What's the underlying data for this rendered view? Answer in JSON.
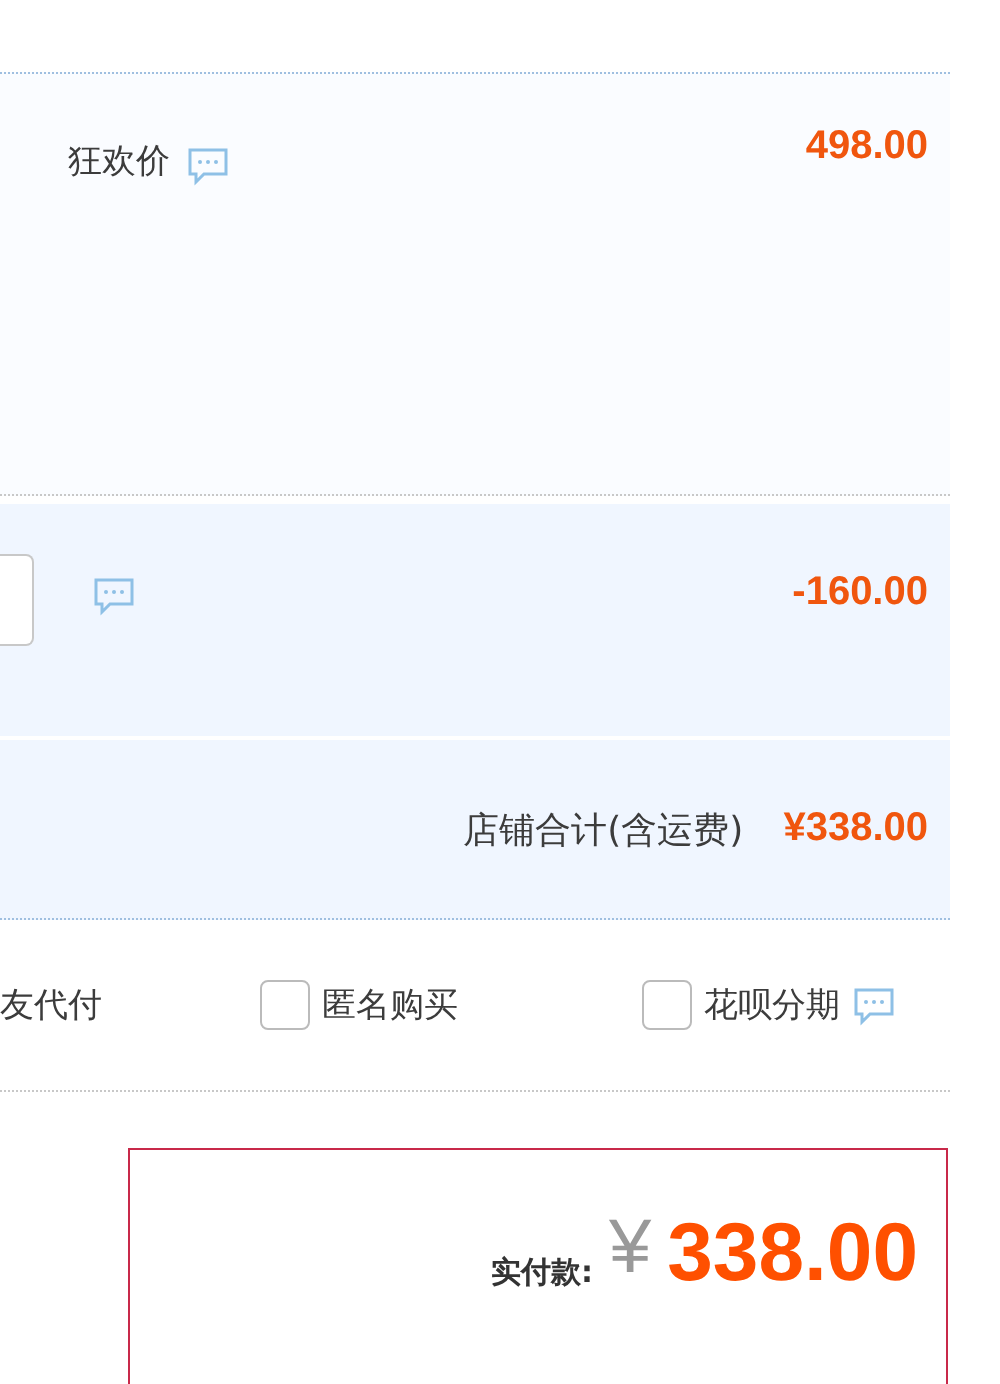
{
  "price_row": {
    "label": "狂欢价",
    "amount": "498.00"
  },
  "discount_row": {
    "amount": "-160.00"
  },
  "shop_total": {
    "label": "店铺合计(含运费)",
    "amount": "¥338.00"
  },
  "options": [
    {
      "kind": "plain",
      "label": "友代付",
      "info": false
    },
    {
      "kind": "checkbox",
      "label": "匿名购买",
      "checked": false,
      "info": false
    },
    {
      "kind": "checkbox",
      "label": "花呗分期",
      "checked": false,
      "info": true
    }
  ],
  "payment": {
    "label": "实付款:",
    "currency": "¥",
    "amount": "338.00"
  }
}
